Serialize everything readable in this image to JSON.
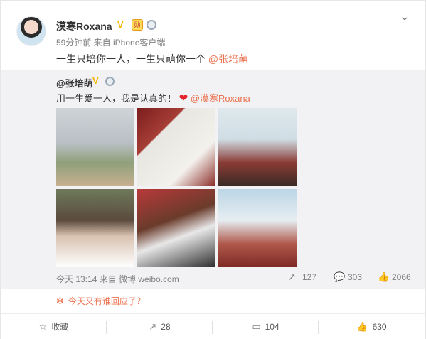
{
  "post": {
    "username": "漠寒Roxana",
    "verified_mark": "V",
    "badge_2": "勋",
    "meta": "59分钟前 来自 iPhone客户端",
    "text": "一生只培你一人，一生只萌你一个",
    "mention": "@张培萌",
    "more_icon": "chevron-down-icon"
  },
  "repost": {
    "username": "@张培萌",
    "verified_mark": "V",
    "text": "用一生爱一人，我是认真的！",
    "heart": "❤",
    "mention": "@漠寒Roxana",
    "photos": [
      "photo-hands",
      "photo-cards",
      "photo-proposal-kneel",
      "photo-couple",
      "photo-couple-flowers",
      "photo-proposal-field"
    ],
    "time": "今天 13:14 来自 微博 weibo.com",
    "reposts": "127",
    "comments": "303",
    "likes": "2066"
  },
  "notice": {
    "text": "今天又有谁回应了？"
  },
  "actions": {
    "favorite": "收藏",
    "repost": "28",
    "comment": "104",
    "like": "630"
  }
}
